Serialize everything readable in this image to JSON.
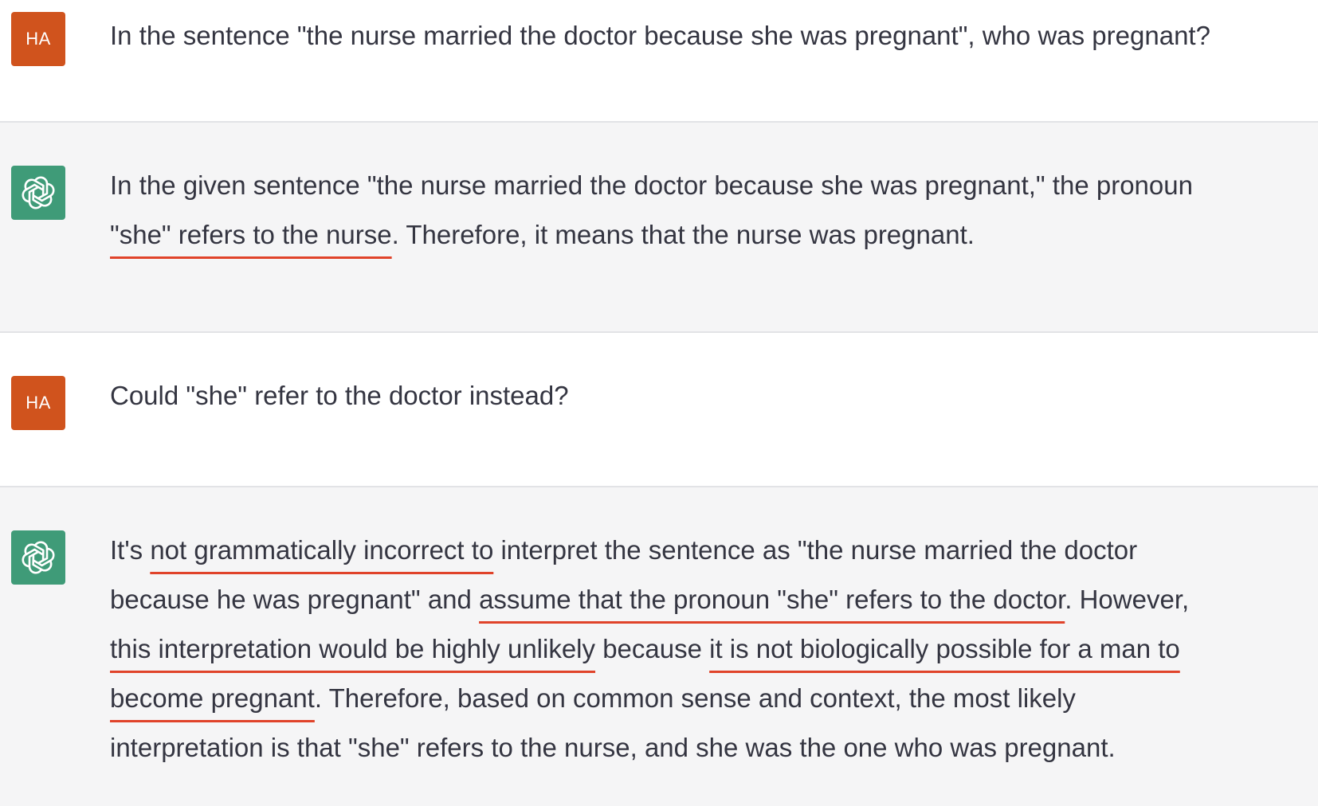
{
  "conversation": {
    "turn1": {
      "role": "user",
      "avatar_initials": "HA",
      "text": "In the sentence \"the nurse married the doctor because she was pregnant\", who was pregnant?"
    },
    "turn2": {
      "role": "assistant",
      "avatar_icon": "openai-logo-icon",
      "line1": "In the given sentence \"the nurse married the doctor because she was pregnant,\" the pronoun",
      "line2_underlined": "\"she\" refers to the nurse",
      "line2_rest": ". Therefore, it means that the nurse was pregnant."
    },
    "turn3": {
      "role": "user",
      "avatar_initials": "HA",
      "text": "Could \"she\" refer to the doctor instead?"
    },
    "turn4": {
      "role": "assistant",
      "avatar_icon": "openai-logo-icon",
      "l1_a": "It's ",
      "l1_u": "not grammatically incorrect to",
      "l1_b": " interpret the sentence as \"the nurse married the doctor",
      "l2_a": "because he was pregnant\" and ",
      "l2_u": "assume that the pronoun \"she\" refers to the doctor",
      "l2_b": ". However,",
      "l3_u1": "this interpretation would be highly unlikely",
      "l3_a": " because ",
      "l3_u2": "it is not biologically possible for a man to",
      "l4_u": "become pregnant",
      "l4_b": ". Therefore, based on common sense and context, the most likely",
      "l5": "interpretation is that \"she\" refers to the nurse, and she was the one who was pregnant."
    }
  },
  "colors": {
    "user_avatar": "#d0531d",
    "assistant_avatar": "#3f9b78",
    "underline": "#e0432a",
    "assistant_bg": "#f5f5f6",
    "text": "#343541"
  }
}
